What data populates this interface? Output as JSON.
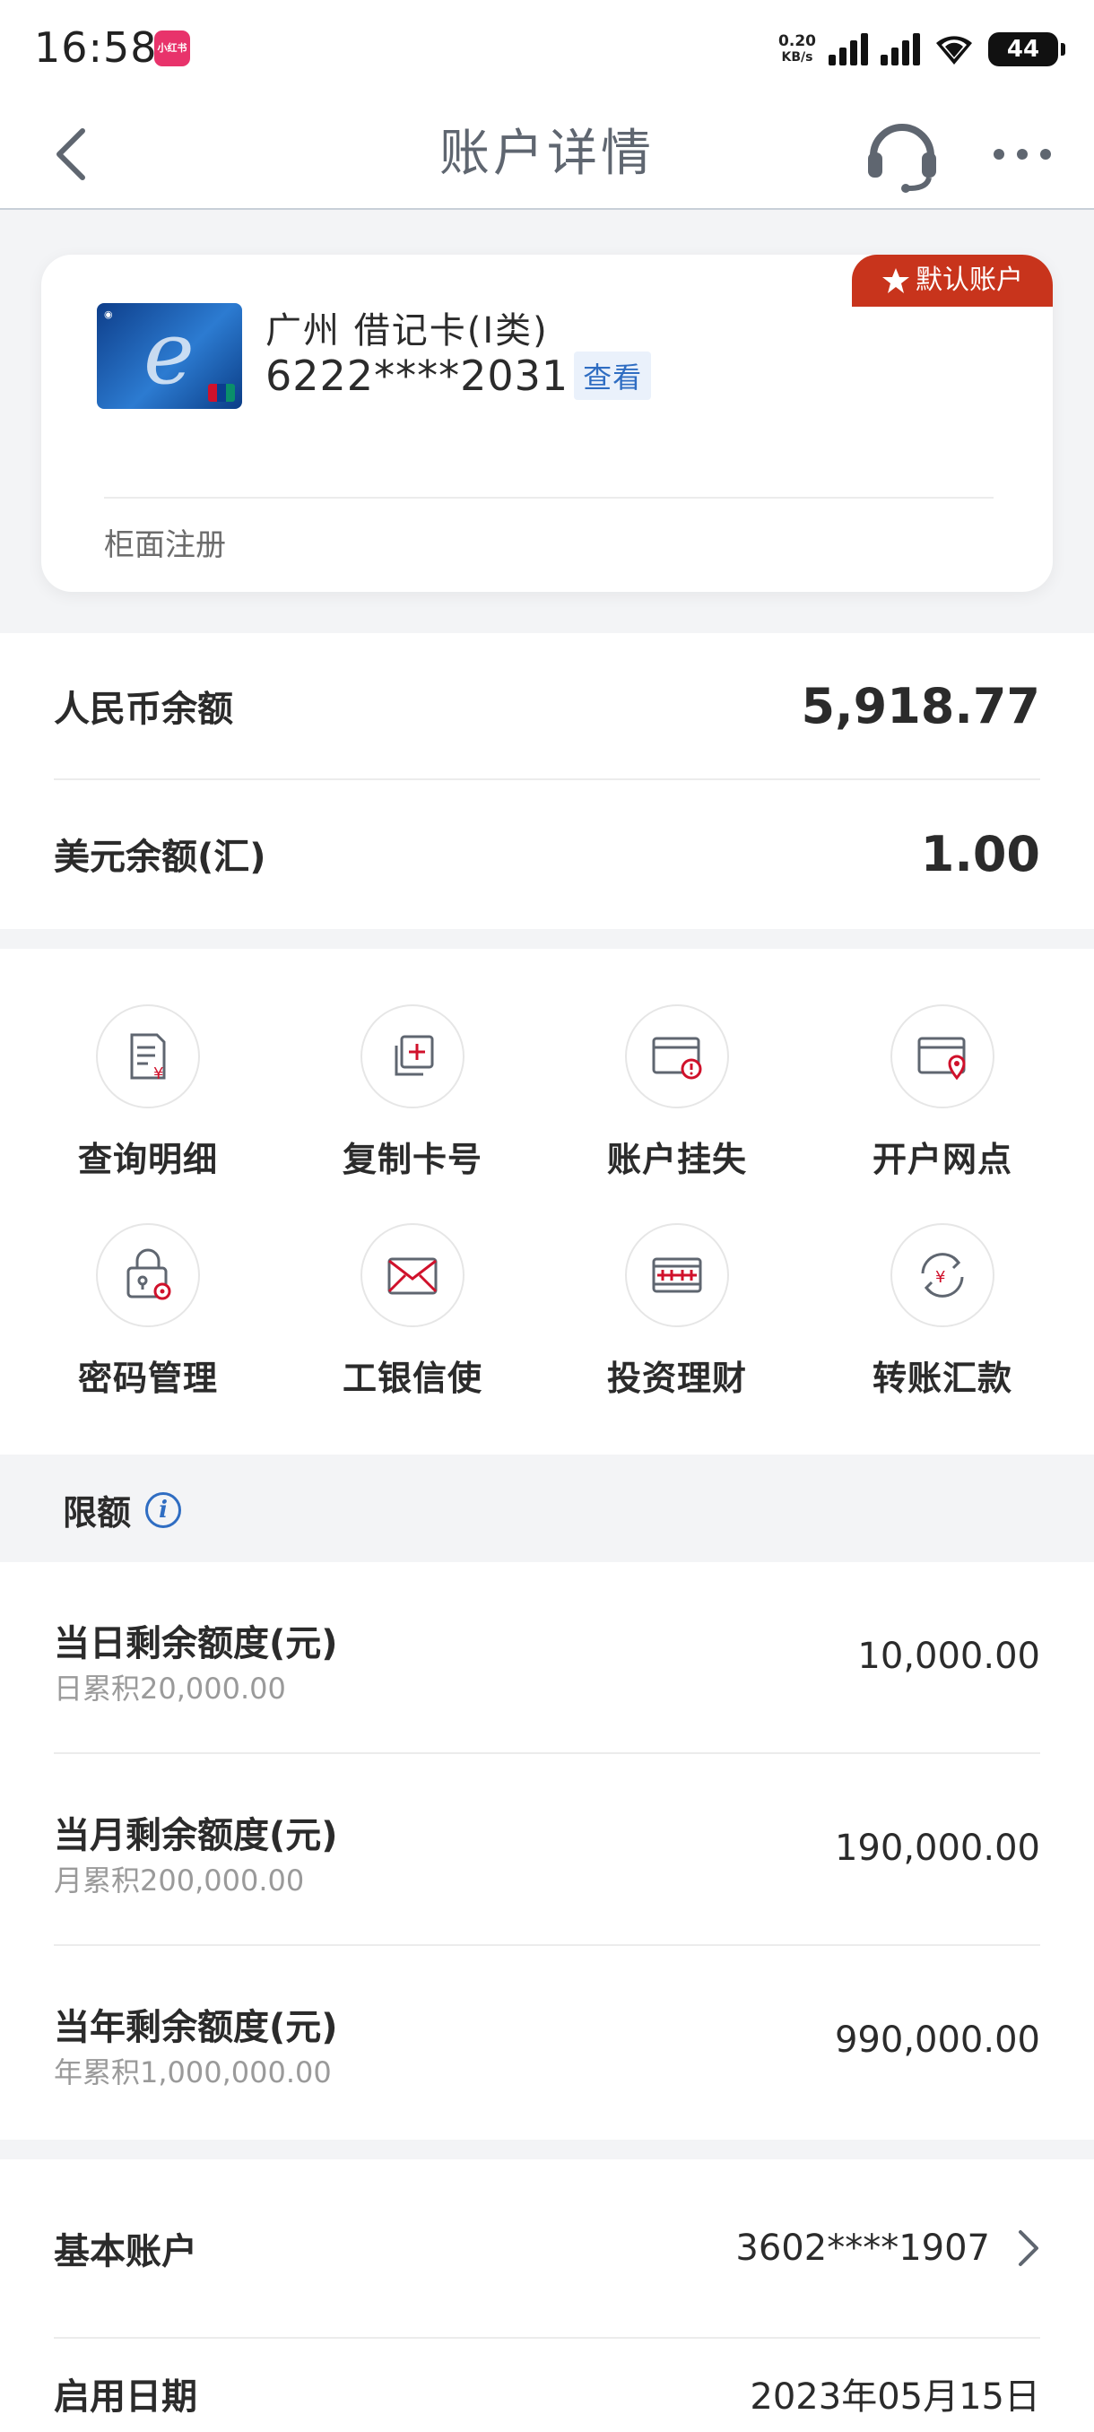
{
  "status_bar": {
    "time": "16:58",
    "app_badge": "小红书",
    "net_speed_value": "0.20",
    "net_speed_unit": "KB/s",
    "battery": "44"
  },
  "nav": {
    "title": "账户详情",
    "icons": [
      "back-icon",
      "customer-service-icon",
      "more-icon"
    ]
  },
  "card": {
    "default_badge": "默认账户",
    "name": "广州 借记卡(Ⅰ类)",
    "number": "6222****2031",
    "view_label": "查看",
    "registration": "柜面注册"
  },
  "balances": [
    {
      "label": "人民币余额",
      "value": "5,918.77"
    },
    {
      "label": "美元余额(汇)",
      "value": "1.00"
    }
  ],
  "functions": [
    {
      "label": "查询明细",
      "icon": "statement-icon"
    },
    {
      "label": "复制卡号",
      "icon": "copy-card-icon"
    },
    {
      "label": "账户挂失",
      "icon": "report-loss-icon"
    },
    {
      "label": "开户网点",
      "icon": "branch-location-icon"
    },
    {
      "label": "密码管理",
      "icon": "password-lock-icon"
    },
    {
      "label": "工银信使",
      "icon": "envelope-icon"
    },
    {
      "label": "投资理财",
      "icon": "invest-icon"
    },
    {
      "label": "转账汇款",
      "icon": "transfer-icon"
    }
  ],
  "limits": {
    "title": "限额",
    "rows": [
      {
        "label": "当日剩余额度(元)",
        "sub": "日累积20,000.00",
        "value": "10,000.00"
      },
      {
        "label": "当月剩余额度(元)",
        "sub": "月累积200,000.00",
        "value": "190,000.00"
      },
      {
        "label": "当年剩余额度(元)",
        "sub": "年累积1,000,000.00",
        "value": "990,000.00"
      }
    ]
  },
  "account_info": [
    {
      "label": "基本账户",
      "value": "3602****1907"
    },
    {
      "label": "启用日期",
      "value": "2023年05月15日"
    }
  ],
  "colors": {
    "accent_red": "#c8341c",
    "link_blue": "#2f6dc2",
    "icon_red": "#d0112b"
  }
}
